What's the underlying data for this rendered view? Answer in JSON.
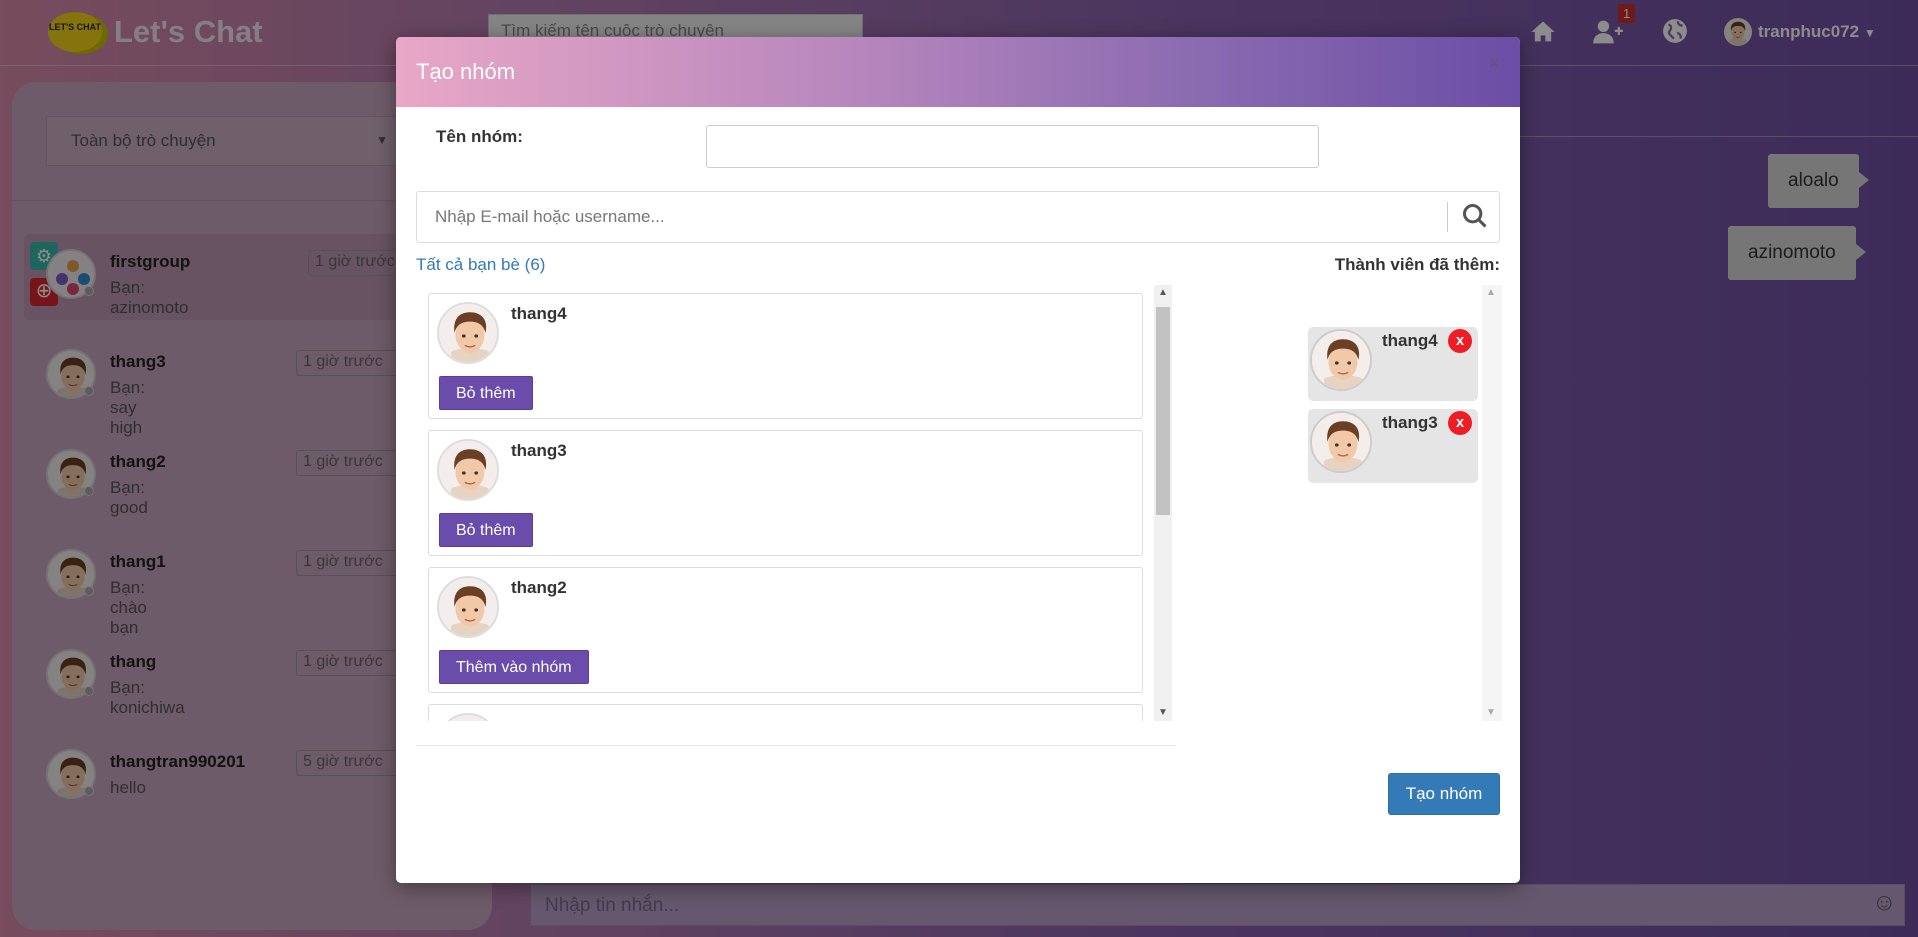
{
  "app": {
    "logo_badge": "LET'S CHAT",
    "title": "Let's Chat",
    "search_placeholder": "Tìm kiếm tên cuộc trò chuyện",
    "notification_count": "1",
    "username": "tranphuc072"
  },
  "sidebar": {
    "filter_label": "Toàn bộ trò chuyện",
    "conversations": [
      {
        "name": "firstgroup",
        "last": "Bạn: azinomoto",
        "time": "1 giờ trước"
      },
      {
        "name": "thang3",
        "last": "Bạn: say high",
        "time": "1 giờ trước"
      },
      {
        "name": "thang2",
        "last": "Bạn: good",
        "time": "1 giờ trước"
      },
      {
        "name": "thang1",
        "last": "Bạn: chào bạn",
        "time": "1 giờ trước"
      },
      {
        "name": "thang",
        "last": "Bạn: konichiwa",
        "time": "1 giờ trước"
      },
      {
        "name": "thangtran990201",
        "last": "hello",
        "time": "5 giờ trước"
      }
    ]
  },
  "chat": {
    "messages": [
      "aloalo",
      "azinomoto"
    ],
    "input_placeholder": "Nhập tin nhắn..."
  },
  "modal": {
    "title": "Tạo nhóm",
    "close": "×",
    "group_name_label": "Tên nhóm:",
    "search_placeholder": "Nhập E-mail hoặc username...",
    "all_friends": "Tất cả bạn bè (6)",
    "added_members_title": "Thành viên đã thêm:",
    "friends": [
      {
        "name": "thang4",
        "action": "Bỏ thêm"
      },
      {
        "name": "thang3",
        "action": "Bỏ thêm"
      },
      {
        "name": "thang2",
        "action": "Thêm vào nhóm"
      }
    ],
    "members": [
      {
        "name": "thang4",
        "remove": "x"
      },
      {
        "name": "thang3",
        "remove": "x"
      }
    ],
    "create_button": "Tạo nhóm"
  }
}
